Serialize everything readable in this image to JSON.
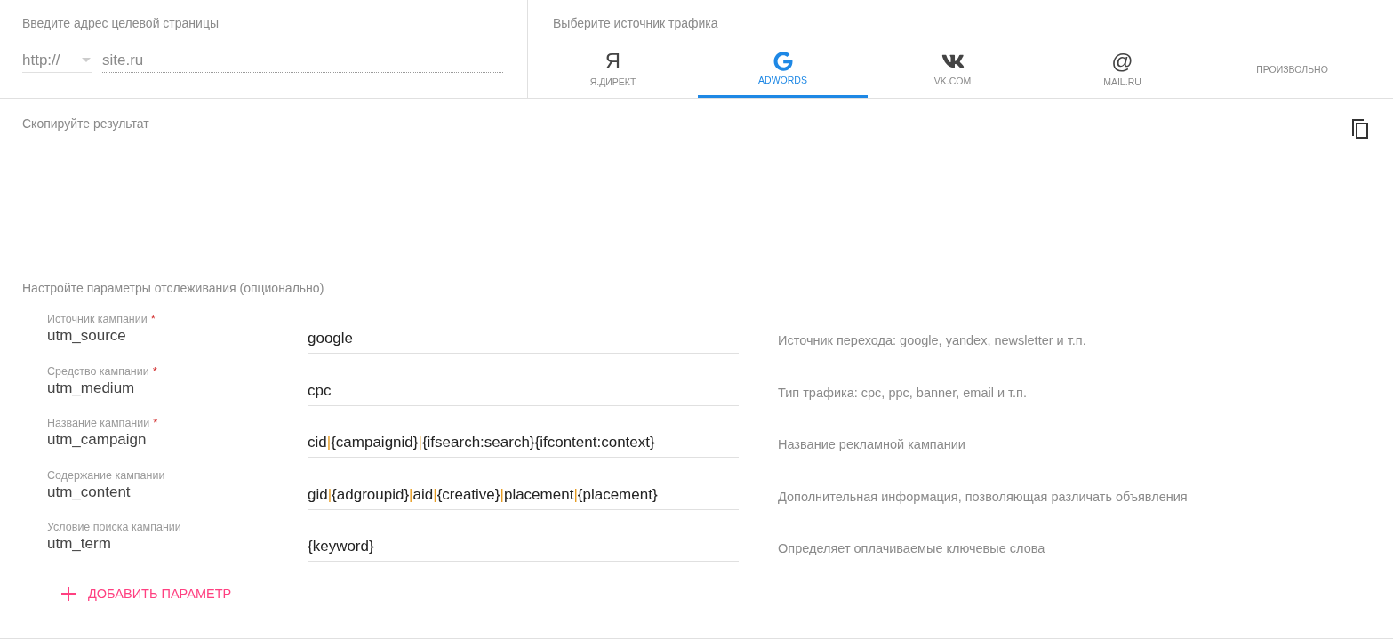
{
  "url_section": {
    "label": "Введите адрес целевой страницы",
    "protocol": "http://",
    "placeholder": "site.ru"
  },
  "source_section": {
    "label": "Выберите источник трафика",
    "tabs": [
      {
        "kind": "yandex",
        "glyph": "Я",
        "label": "Я.ДИРЕКТ",
        "selected": false
      },
      {
        "kind": "google",
        "label": "ADWORDS",
        "selected": true
      },
      {
        "kind": "vk",
        "label": "VK.COM",
        "selected": false
      },
      {
        "kind": "mail",
        "glyph": "@",
        "label": "MAIL.RU",
        "selected": false
      },
      {
        "kind": "custom",
        "label": "ПРОИЗВОЛЬНО",
        "selected": false
      }
    ]
  },
  "result_section": {
    "label": "Скопируйте результат"
  },
  "params_section": {
    "label": "Настройте параметры отслеживания (опционально)",
    "params": [
      {
        "caption": "Источник кампании",
        "required_mark": "*",
        "name": "utm_source",
        "value": "google",
        "description": "Источник перехода: google, yandex, newsletter и т.п."
      },
      {
        "caption": "Средство кампании",
        "required_mark": "*",
        "name": "utm_medium",
        "value": "cpc",
        "description": "Тип трафика: cpc, ppc, banner, email и т.п."
      },
      {
        "caption": "Название кампании",
        "required_mark": "*",
        "name": "utm_campaign",
        "value": "cid|{campaignid}|{ifsearch:search}{ifcontent:context}",
        "description": "Название рекламной кампании"
      },
      {
        "caption": "Содержание кампании",
        "name": "utm_content",
        "value": "gid|{adgroupid}|aid|{creative}|placement|{placement}",
        "description": "Дополнительная информация, позволяющая различать объявления"
      },
      {
        "caption": "Условие поиска кампании",
        "name": "utm_term",
        "value": "{keyword}",
        "description": "Определяет оплачиваемые ключевые слова"
      }
    ],
    "add_button": "ДОБАВИТЬ ПАРАМЕТР"
  }
}
